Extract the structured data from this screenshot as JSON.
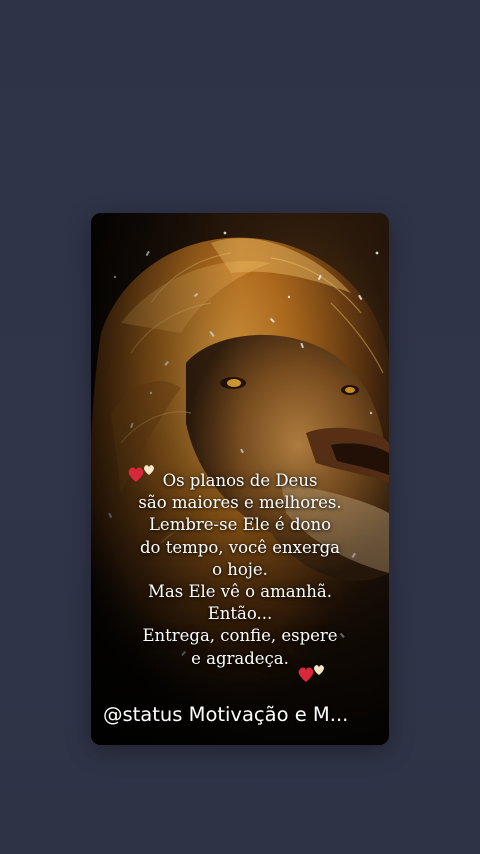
{
  "story": {
    "quote_lines": [
      "Os planos de Deus",
      "são maiores e melhores.",
      "Lembre-se Ele é dono",
      "do tempo, você enxerga",
      "o hoje.",
      "Mas Ele vê o amanhã.",
      "Então...",
      "Entrega, confie, espere",
      "e agradeça."
    ],
    "watermark": "@status Motivação e M...",
    "background_image": "lion-portrait",
    "decor_icons": [
      "hearts-icon",
      "hearts-icon"
    ]
  },
  "colors": {
    "page_background": "#30344a",
    "text": "#ffffff",
    "heart_red": "#d8283a",
    "heart_cream": "#f6e8c6",
    "lion_gold": "#c98a2c"
  }
}
